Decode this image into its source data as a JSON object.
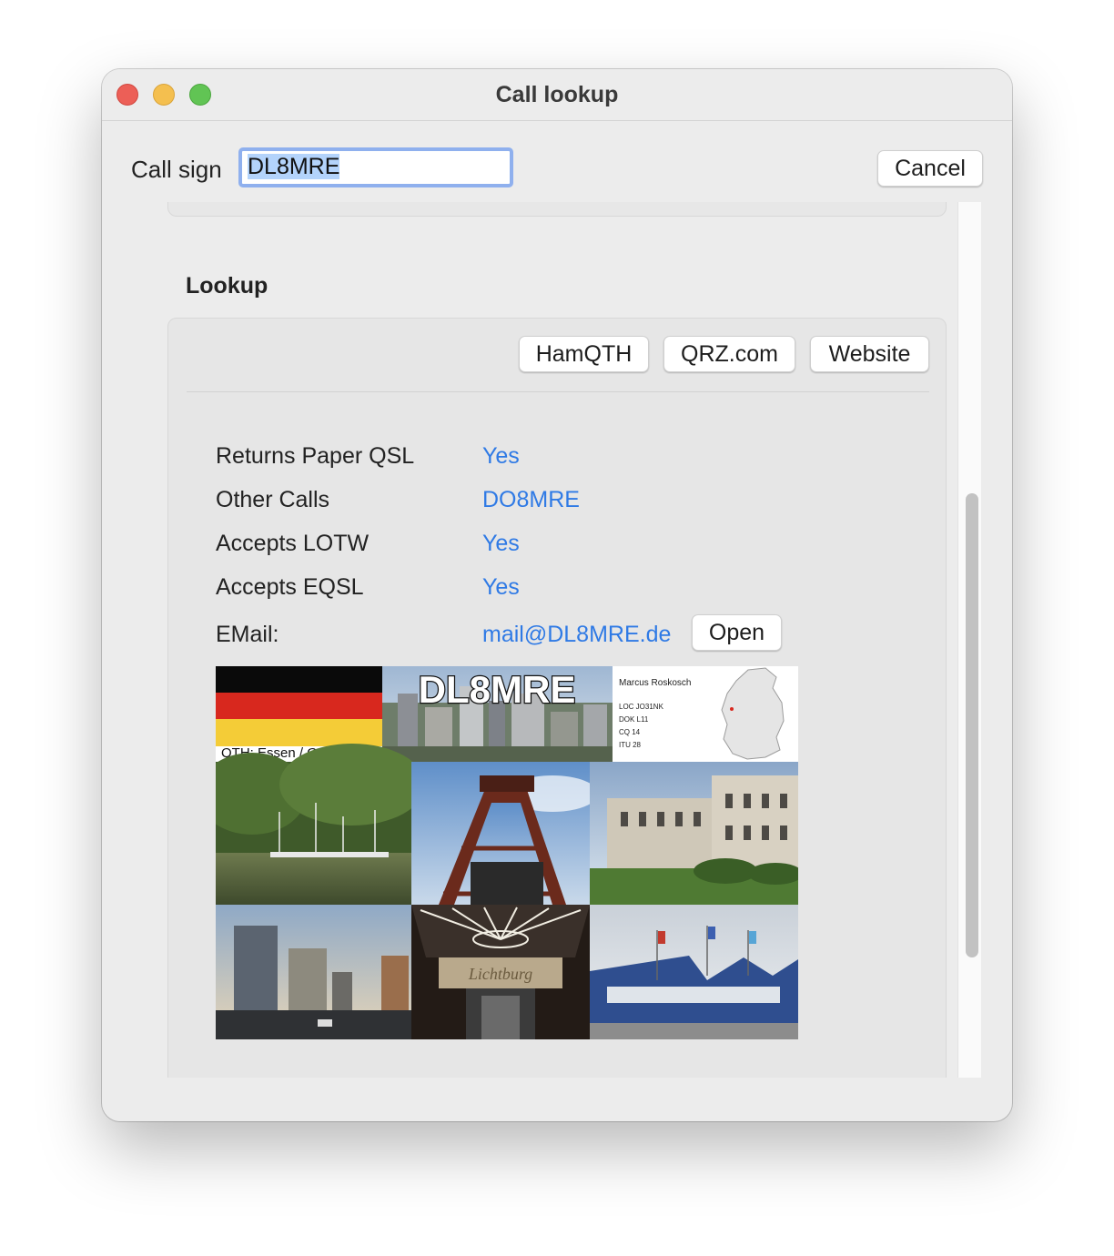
{
  "window": {
    "title": "Call lookup"
  },
  "callsign": {
    "label": "Call sign",
    "value": "DL8MRE"
  },
  "cancel_label": "Cancel",
  "lookup": {
    "section_title": "Lookup",
    "buttons": {
      "hamqth": "HamQTH",
      "qrz": "QRZ.com",
      "website": "Website"
    },
    "rows": [
      {
        "label": "Returns Paper QSL",
        "value": "Yes"
      },
      {
        "label": "Other Calls",
        "value": "DO8MRE"
      },
      {
        "label": "Accepts LOTW",
        "value": "Yes"
      },
      {
        "label": "Accepts EQSL",
        "value": "Yes"
      }
    ],
    "email": {
      "label": "EMail:",
      "value": "mail@DL8MRE.de",
      "open_label": "Open"
    }
  },
  "qsl_card": {
    "callsign": "DL8MRE",
    "qth": "QTH: Essen / Germany",
    "name": "Marcus Roskosch",
    "info": [
      "LOC JO31NK",
      "DOK L11",
      "CQ 14",
      "ITU 28"
    ],
    "sign_text": "Lichtburg",
    "colors": {
      "flag_black": "#0a0a0a",
      "flag_red": "#d8281e",
      "flag_gold": "#f4cc37"
    }
  }
}
